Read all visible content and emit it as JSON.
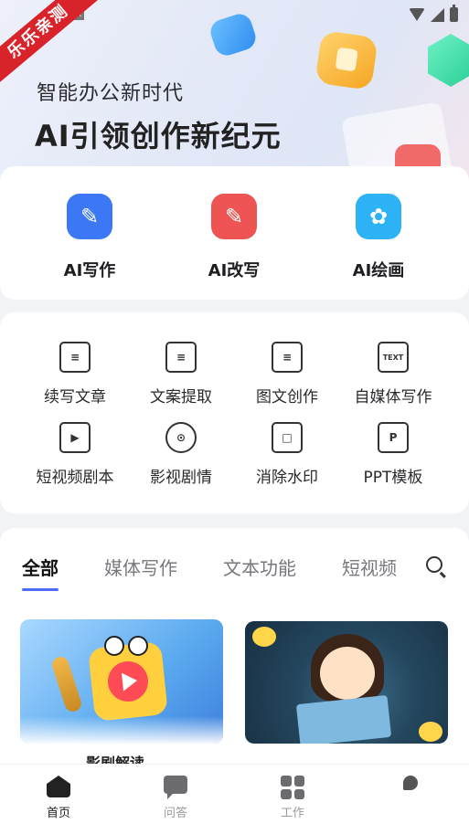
{
  "badge": {
    "text": "乐乐亲测"
  },
  "banner": {
    "subtitle": "智能办公新时代",
    "headline": "AI引领创作新纪元"
  },
  "main_tools": [
    {
      "label": "AI写作",
      "icon": "pencil-icon",
      "color": "#3c78f5"
    },
    {
      "label": "AI改写",
      "icon": "edit-icon",
      "color": "#ef5454"
    },
    {
      "label": "AI绘画",
      "icon": "palette-icon",
      "color": "#2cb2f5"
    }
  ],
  "tools": [
    {
      "label": "续写文章",
      "icon": "document-edit-icon"
    },
    {
      "label": "文案提取",
      "icon": "inbox-tray-icon"
    },
    {
      "label": "图文创作",
      "icon": "document-lines-icon"
    },
    {
      "label": "自媒体写作",
      "icon": "text-calendar-icon",
      "glyph": "TEXT"
    },
    {
      "label": "短视频剧本",
      "icon": "video-camera-icon"
    },
    {
      "label": "影视剧情",
      "icon": "film-reel-icon"
    },
    {
      "label": "消除水印",
      "icon": "watermark-frame-icon"
    },
    {
      "label": "PPT模板",
      "icon": "ppt-file-icon",
      "glyph": "P"
    }
  ],
  "tabs": [
    {
      "label": "全部",
      "active": true
    },
    {
      "label": "媒体写作"
    },
    {
      "label": "文本功能"
    },
    {
      "label": "短视频"
    }
  ],
  "cards": [
    {
      "caption": "影剧解读"
    }
  ],
  "bottom_nav": [
    {
      "label": "首页",
      "icon": "home-icon",
      "active": true
    },
    {
      "label": "问答",
      "icon": "chat-icon"
    },
    {
      "label": "工作",
      "icon": "grid-icon"
    },
    {
      "label": "",
      "icon": "profile-icon"
    }
  ],
  "colors": {
    "accent": "#4a6cf7",
    "badge": "#d8232a"
  }
}
